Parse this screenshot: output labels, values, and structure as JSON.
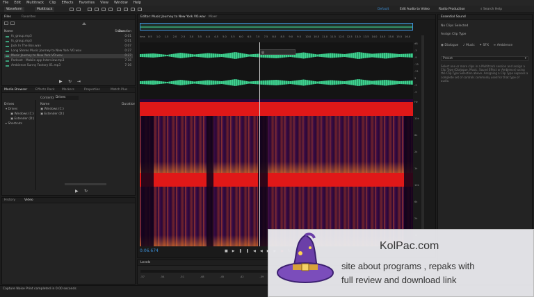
{
  "menu": [
    "File",
    "Edit",
    "Multitrack",
    "Clip",
    "Effects",
    "Favorites",
    "View",
    "Window",
    "Help"
  ],
  "toolbar": {
    "waveform_label": "Waveform",
    "multitrack_label": "Multitrack",
    "workspace_default": "Default",
    "workspace_edit_video": "Edit Audio to Video",
    "workspace_radio": "Radio Production",
    "search_placeholder": "Search Help"
  },
  "files_panel": {
    "tabs": [
      "Files",
      "Favorites"
    ],
    "col_name": "Name",
    "col_status": "Status",
    "col_duration": "Duration",
    "files": [
      {
        "name": "fx_group.mp3",
        "duration": "0:01"
      },
      {
        "name": "fx_group.mp3",
        "duration": "0:01"
      },
      {
        "name": "Jack In The Box.wav",
        "duration": "0:07"
      },
      {
        "name": "Long Stereo Music Journey to New York VO.wav",
        "duration": "0:27"
      },
      {
        "name": "Music Journey to New York VO.wav",
        "duration": "0:27"
      },
      {
        "name": "Podcast - Mobile app Interview.mp3",
        "duration": "7:16"
      },
      {
        "name": "Ambience Sunny Factory 01.mp3",
        "duration": "7:16"
      }
    ]
  },
  "media_browser": {
    "tabs": [
      "Media Browser",
      "Effects Rack",
      "Markers",
      "Properties",
      "Match Plus"
    ],
    "contents_label": "Contents:",
    "contents_value": "Drives",
    "drives_label": "Drives",
    "col_name": "Name",
    "col_duration": "Duration",
    "tree": [
      "Drives",
      "Windows (C:)",
      "Extender (D:)",
      "Shortcuts"
    ],
    "list": [
      "Windows (C:)",
      "Extender (D:)"
    ]
  },
  "history_panel": {
    "tabs": [
      "History",
      "Video"
    ]
  },
  "editor": {
    "tab_label": "Editor: Music Journey to New York VO.wav",
    "mixer_tab": "Mixer",
    "ruler_labels": [
      "hms",
      "0:5",
      "1.0",
      "1.5",
      "2.0",
      "2.5",
      "3.0",
      "3.5",
      "4.0",
      "4.5",
      "5.0",
      "5.5",
      "6.0",
      "6.5",
      "7.0",
      "7.5",
      "8.0",
      "8.5",
      "9.0",
      "9.5",
      "10.0",
      "10.5",
      "11.0",
      "11.5",
      "12.0",
      "12.5",
      "13.0",
      "13.5",
      "14.0",
      "14.5",
      "15.0",
      "15.5",
      "16.0"
    ],
    "db_scale": [
      "dB",
      "-3",
      "-9",
      "-15",
      "-21",
      "3",
      "-3",
      "-9"
    ],
    "hz_scale": [
      "Hz",
      "10k",
      "6k",
      "2k",
      "1k",
      "10k",
      "6k",
      "2k",
      "1k"
    ],
    "time_readout": "0:06.674"
  },
  "levels_panel": {
    "tab": "Levels",
    "marks": [
      "-57",
      "-54",
      "-51",
      "-48",
      "-45",
      "-42",
      "-39",
      "-36",
      "-33",
      "-30",
      "-27",
      "-24",
      "-21",
      "-18"
    ]
  },
  "essential_sound": {
    "title": "Essential Sound",
    "no_selection": "No Clips Selected",
    "preset_label": "Preset",
    "assign_label": "Assign Clip Type",
    "types": [
      "Dialogue",
      "Music",
      "SFX",
      "Ambience"
    ],
    "help_text": "Select one or more clips in a Multitrack session and assign a Clip Type (Dialogue, Music, Sound Effect or Ambience) using the Clip Type Selection above. Assigning a Clip Type exposes a complete set of controls commonly used for that type of audio."
  },
  "status_bar": {
    "text": "Capture Noise Print completed in 0.00 seconds"
  },
  "watermark": {
    "site": "KolPac.com",
    "line1": "site about programs , repaks with",
    "line2": "full review and download link"
  },
  "colors": {
    "waveform": "#3fcf8e",
    "spectral_band": "#e01818",
    "spectral_bg": "#2a0738",
    "accent": "#3c8fd6"
  }
}
